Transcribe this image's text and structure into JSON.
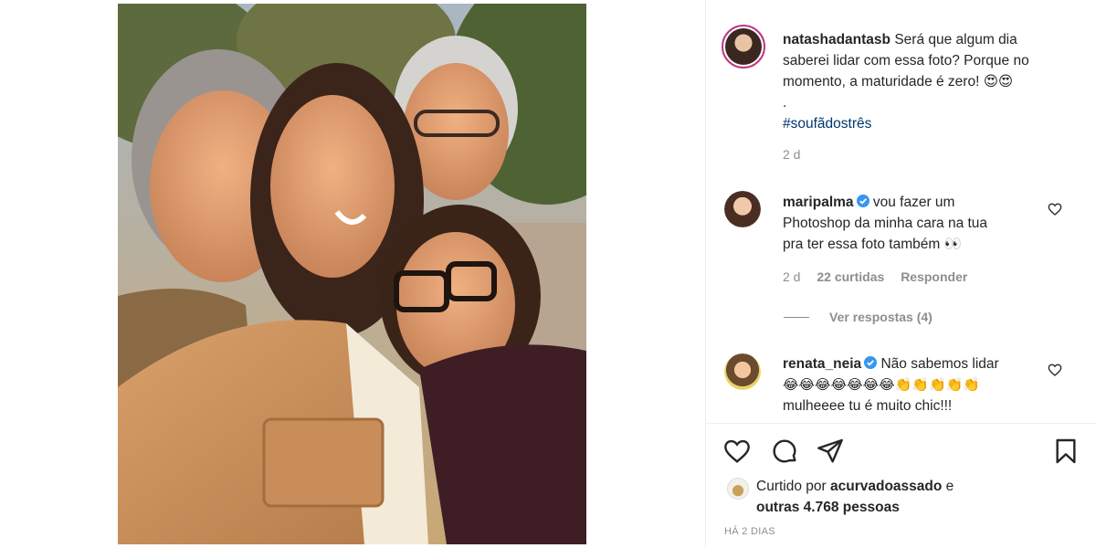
{
  "post": {
    "author": "natashadantasb",
    "caption_line1": "Será que algum dia",
    "caption_line2": "saberei lidar com essa foto? Porque no",
    "caption_line3": "momento, a maturidade é zero! 😍😍",
    "caption_dot": ".",
    "hashtag": "#soufãdostrês",
    "age": "2 d"
  },
  "comments": [
    {
      "username": "maripalma",
      "verified": true,
      "line1": "vou fazer um",
      "line2": "Photoshop da minha cara na tua",
      "line3": "pra ter essa foto também 👀",
      "age": "2 d",
      "likes": "22 curtidas",
      "reply_label": "Responder",
      "view_replies": "Ver respostas (4)"
    },
    {
      "username": "renata_neia",
      "verified": true,
      "line1": "Não sabemos lidar",
      "line2": "😂😂😂😂😂😂😂👏👏👏👏👏",
      "line3": "mulheeee tu é muito chic!!!"
    }
  ],
  "likes": {
    "prefix": "Curtido por",
    "by": "acurvadoassado",
    "conj": "e",
    "others": "outras 4.768 pessoas"
  },
  "timestamp": "HÁ 2 DIAS",
  "icons": [
    "heart-icon",
    "comment-icon",
    "share-icon",
    "bookmark-icon",
    "verified-icon"
  ],
  "colors": {
    "text": "#262626",
    "muted": "#8e8e8e",
    "hashtag": "#00376b",
    "verified": "#3897f0",
    "story_ring": "#c13584"
  }
}
